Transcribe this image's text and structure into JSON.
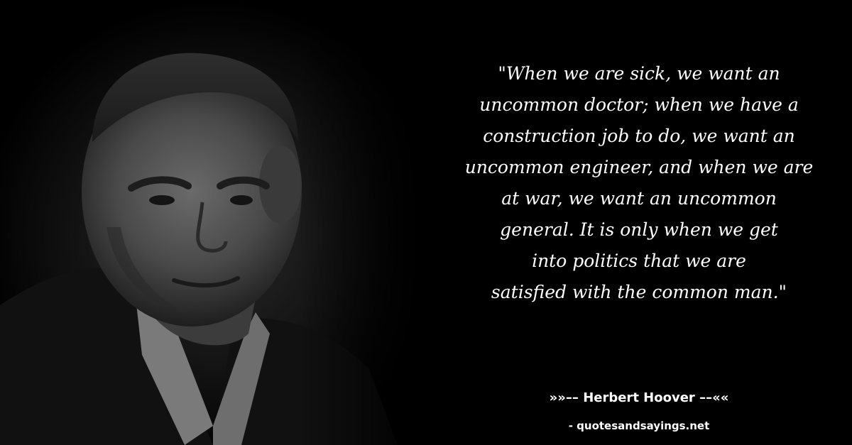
{
  "quote": {
    "lines": [
      "\"When we are sick, we want an",
      "uncommon doctor; when we have a",
      "construction job to do, we want an",
      "uncommon engineer, and when we are",
      "at war, we want an uncommon",
      "general. It is only when we get",
      "into politics that we are",
      "satisfied with the common man.\""
    ]
  },
  "author": {
    "text": "»»–– Herbert Hoover ––««"
  },
  "source": {
    "text": "- quotesandsayings.net"
  },
  "colors": {
    "background": "#000000",
    "text": "#ffffff"
  },
  "portrait": {
    "description_icon": "portrait-photo"
  }
}
